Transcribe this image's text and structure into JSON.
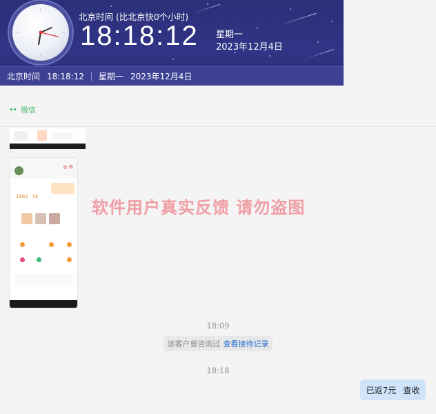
{
  "clock": {
    "zone_label": "北京时间 (比北京快0个小时)",
    "time": "18:18:12",
    "weekday": "星期一",
    "date": "2023年12月4日",
    "status_zone": "北京时间",
    "status_time": "18:18:12",
    "status_weekday": "星期一",
    "status_date": "2023年12月4日"
  },
  "chat": {
    "title": "微信",
    "watermark": "软件用户真实反馈  请勿盗图",
    "timestamp_1": "18:09",
    "notice_text": "该客户曾咨询过",
    "notice_link": "查看接待记录",
    "timestamp_2": "18:18",
    "message_text": "已返7元",
    "message_action": "查收"
  },
  "phone_screenshot": {
    "value_1": "1882",
    "value_2": "5k"
  },
  "colors": {
    "clock_bg": "#2c2f78",
    "accent_green": "#2bae5a",
    "link_blue": "#2a6fd1",
    "bubble_blue": "#cfe3fb",
    "watermark_pink": "#f08c95"
  }
}
